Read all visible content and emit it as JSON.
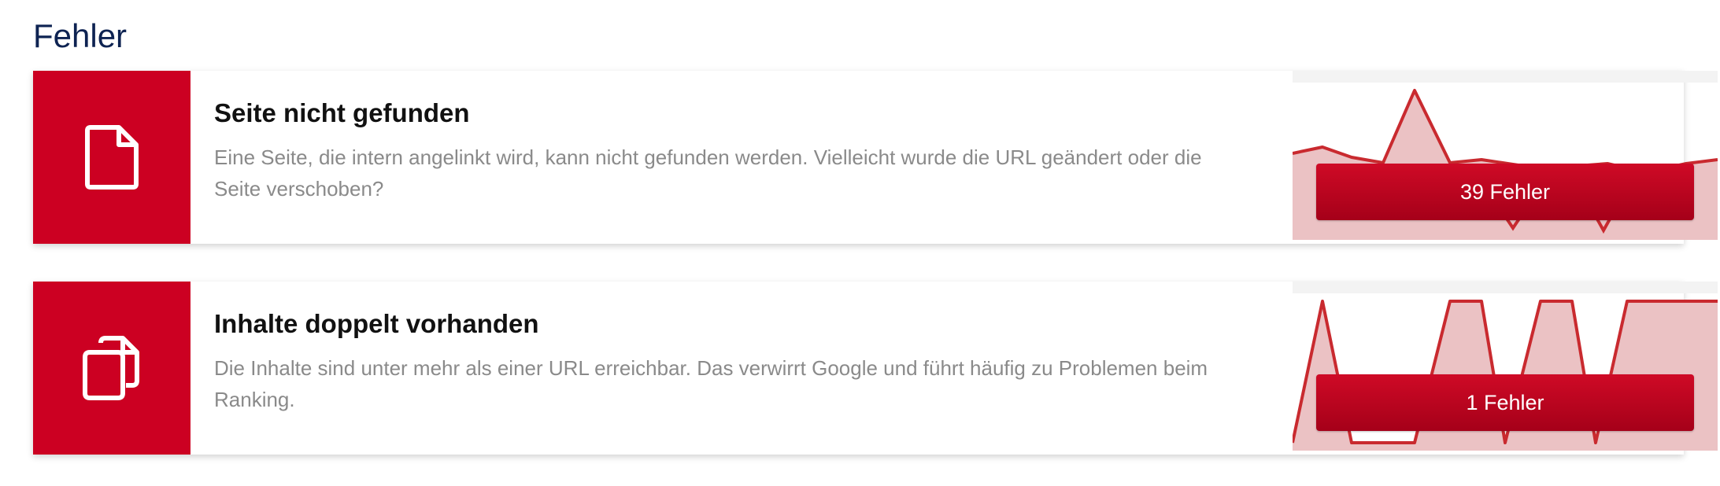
{
  "page": {
    "section_title": "Fehler"
  },
  "theme": {
    "accent": "#cc0022",
    "title_color": "#0e2352",
    "chart_fill": "#ebc2c4",
    "chart_line": "#c92a2f"
  },
  "cards": [
    {
      "icon": "document-icon",
      "title": "Seite nicht gefunden",
      "description": "Eine Seite, die intern angelinkt wird, kann nicht gefunden werden. Vielleicht wurde die URL geändert oder die Seite verschoben?",
      "button_label": "39 Fehler"
    },
    {
      "icon": "duplicate-documents-icon",
      "title": "Inhalte doppelt vorhanden",
      "description": "Die Inhalte sind unter mehr als einer URL erreichbar. Das verwirrt Google und führt häufig zu Problemen beim Ranking.",
      "button_label": "1 Fehler"
    }
  ]
}
